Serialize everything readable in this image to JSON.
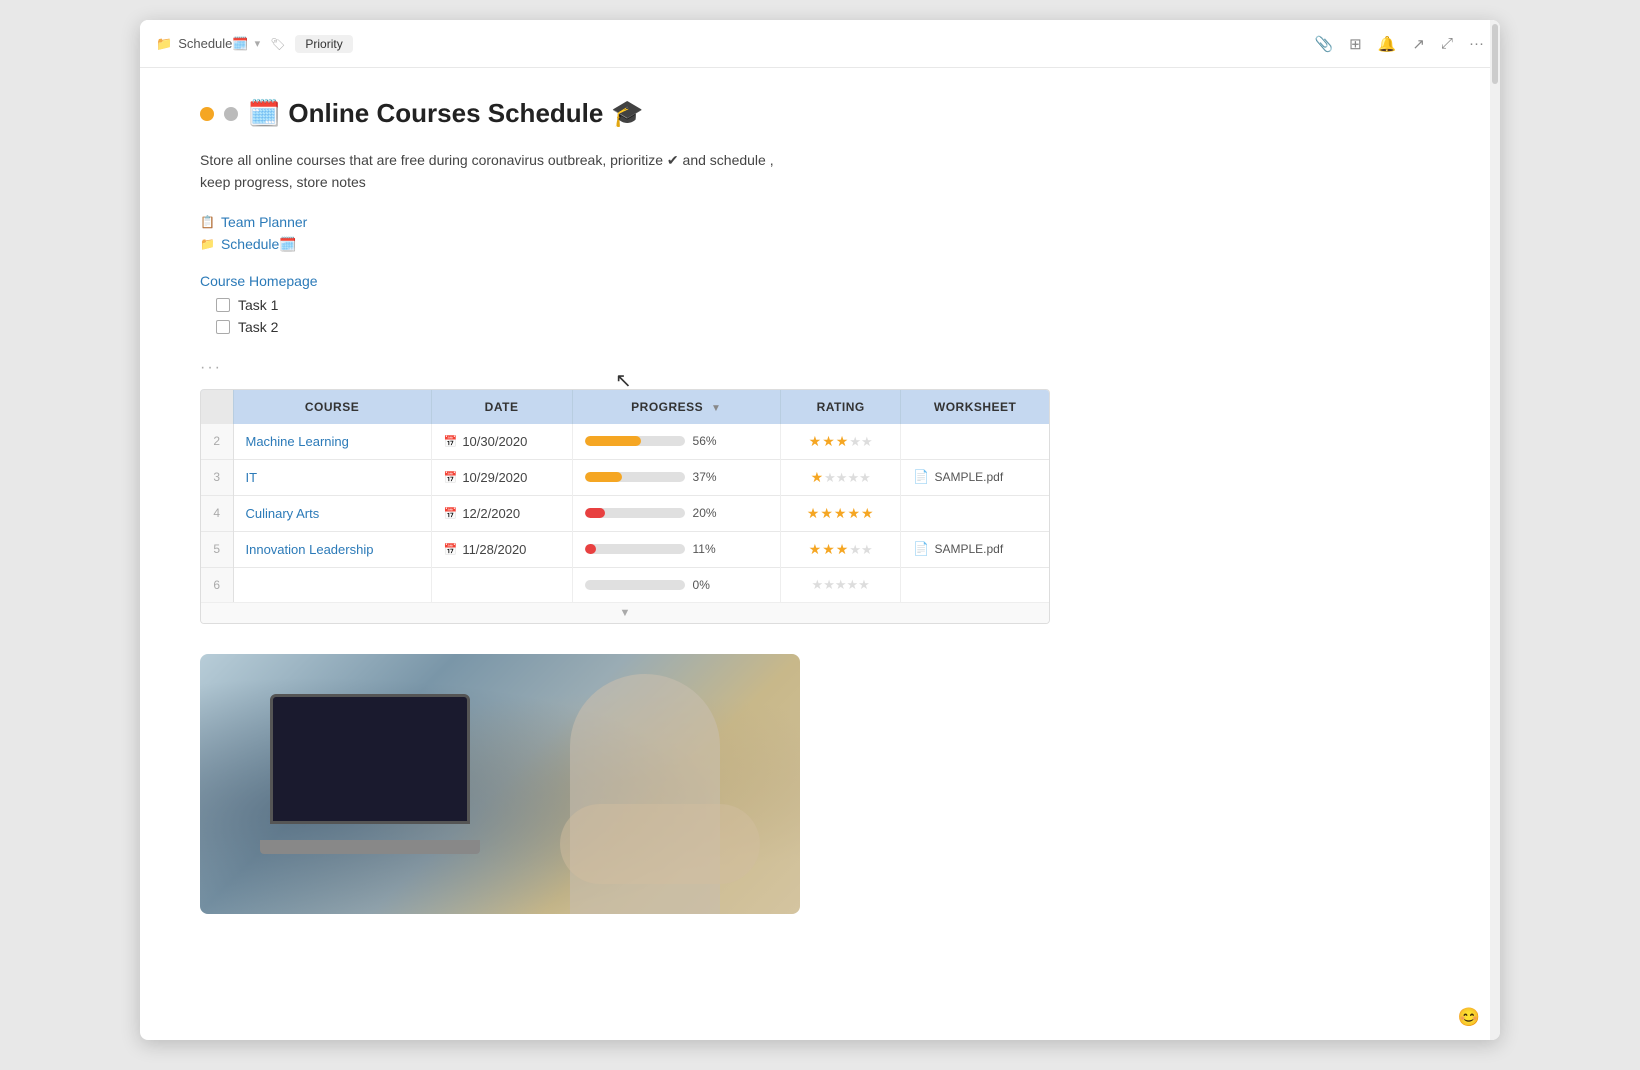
{
  "titlebar": {
    "breadcrumb": {
      "folder_icon": "📁",
      "text": "Schedule🗓️",
      "arrow": "▾",
      "tag": "Priority"
    },
    "icons": [
      "📎",
      "⊞",
      "🔔",
      "⤢",
      "⤡",
      "···"
    ]
  },
  "page": {
    "title": "Online Courses Schedule",
    "title_icon": "🗓️",
    "graduation_icon": "🎓",
    "dot_orange": "orange",
    "dot_gray": "gray",
    "description": "Store all online courses that are free during coronavirus outbreak, prioritize ✔ and schedule , keep progress, store notes",
    "links": [
      {
        "icon": "📋",
        "text": "Team Planner"
      },
      {
        "icon": "📁",
        "text": "Schedule🗓️"
      }
    ],
    "course_homepage": "Course Homepage",
    "tasks": [
      {
        "label": "Task 1",
        "checked": false
      },
      {
        "label": "Task 2",
        "checked": false
      }
    ],
    "dots_menu": "···"
  },
  "table": {
    "columns": [
      "COURSE",
      "DATE",
      "PROGRESS",
      "RATING",
      "WORKSHEET"
    ],
    "rows": [
      {
        "num": 2,
        "course": "Machine Learning",
        "date": "10/30/2020",
        "progress": 56,
        "progress_color": "#f5a623",
        "rating": 3,
        "worksheet": ""
      },
      {
        "num": 3,
        "course": "IT",
        "date": "10/29/2020",
        "progress": 37,
        "progress_color": "#f5a623",
        "rating": 1,
        "worksheet": "SAMPLE.pdf"
      },
      {
        "num": 4,
        "course": "Culinary Arts",
        "date": "12/2/2020",
        "progress": 20,
        "progress_color": "#e84040",
        "rating": 5,
        "worksheet": ""
      },
      {
        "num": 5,
        "course": "Innovation Leadership",
        "date": "11/28/2020",
        "progress": 11,
        "progress_color": "#e84040",
        "rating": 3,
        "worksheet": "SAMPLE.pdf"
      },
      {
        "num": 6,
        "course": "",
        "date": "",
        "progress": 0,
        "progress_color": "#e0e0e0",
        "rating": 0,
        "worksheet": ""
      }
    ]
  },
  "bottom_emoji": "😊"
}
